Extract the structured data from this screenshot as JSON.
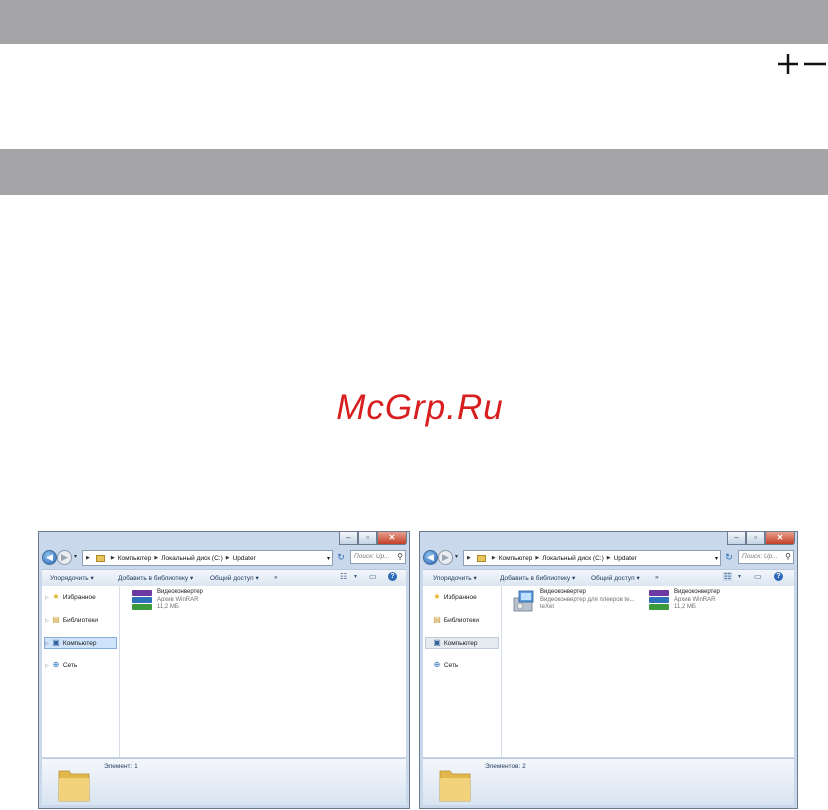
{
  "watermark": "McGrp.Ru",
  "colors": {
    "band": "#a5a5a7",
    "watermark": "#d81e1e",
    "window_frame": "#c9d8ea"
  },
  "windows": [
    {
      "address": [
        "Компьютер",
        "Локальный диск (C:)",
        "Updater"
      ],
      "search_placeholder": "Поиск: Up...",
      "toolbar": {
        "organize": "Упорядочить ▾",
        "add_library": "Добавить в библиотеку ▾",
        "share": "Общий доступ ▾",
        "more": "»"
      },
      "nav": [
        {
          "label": "Избранное",
          "icon": "star-icon"
        },
        {
          "label": "Библиотеки",
          "icon": "library-icon"
        },
        {
          "label": "Компьютер",
          "icon": "computer-icon"
        },
        {
          "label": "Сеть",
          "icon": "network-icon"
        }
      ],
      "files": [
        {
          "name": "Видеоконвертер",
          "type": "Архив WinRAR",
          "size": "11,2 МБ",
          "icon": "winrar-archive-icon"
        }
      ],
      "status": "Элемент: 1"
    },
    {
      "address": [
        "Компьютер",
        "Локальный диск (C:)",
        "Updater"
      ],
      "search_placeholder": "Поиск: Up...",
      "toolbar": {
        "organize": "Упорядочить ▾",
        "add_library": "Добавить в библиотеку ▾",
        "share": "Общий доступ ▾",
        "more": "»"
      },
      "nav": [
        {
          "label": "Избранное",
          "icon": "star-icon"
        },
        {
          "label": "Библиотеки",
          "icon": "library-icon"
        },
        {
          "label": "Компьютер",
          "icon": "computer-icon"
        },
        {
          "label": "Сеть",
          "icon": "network-icon"
        }
      ],
      "files": [
        {
          "name": "Видеоконвертер",
          "type": "Видеоконвертер для плееров te...",
          "size": "teXet",
          "icon": "setup-installer-icon"
        },
        {
          "name": "Видеоконвертер",
          "type": "Архив WinRAR",
          "size": "11,2 МБ",
          "icon": "winrar-archive-icon"
        }
      ],
      "status": "Элементов: 2"
    }
  ]
}
